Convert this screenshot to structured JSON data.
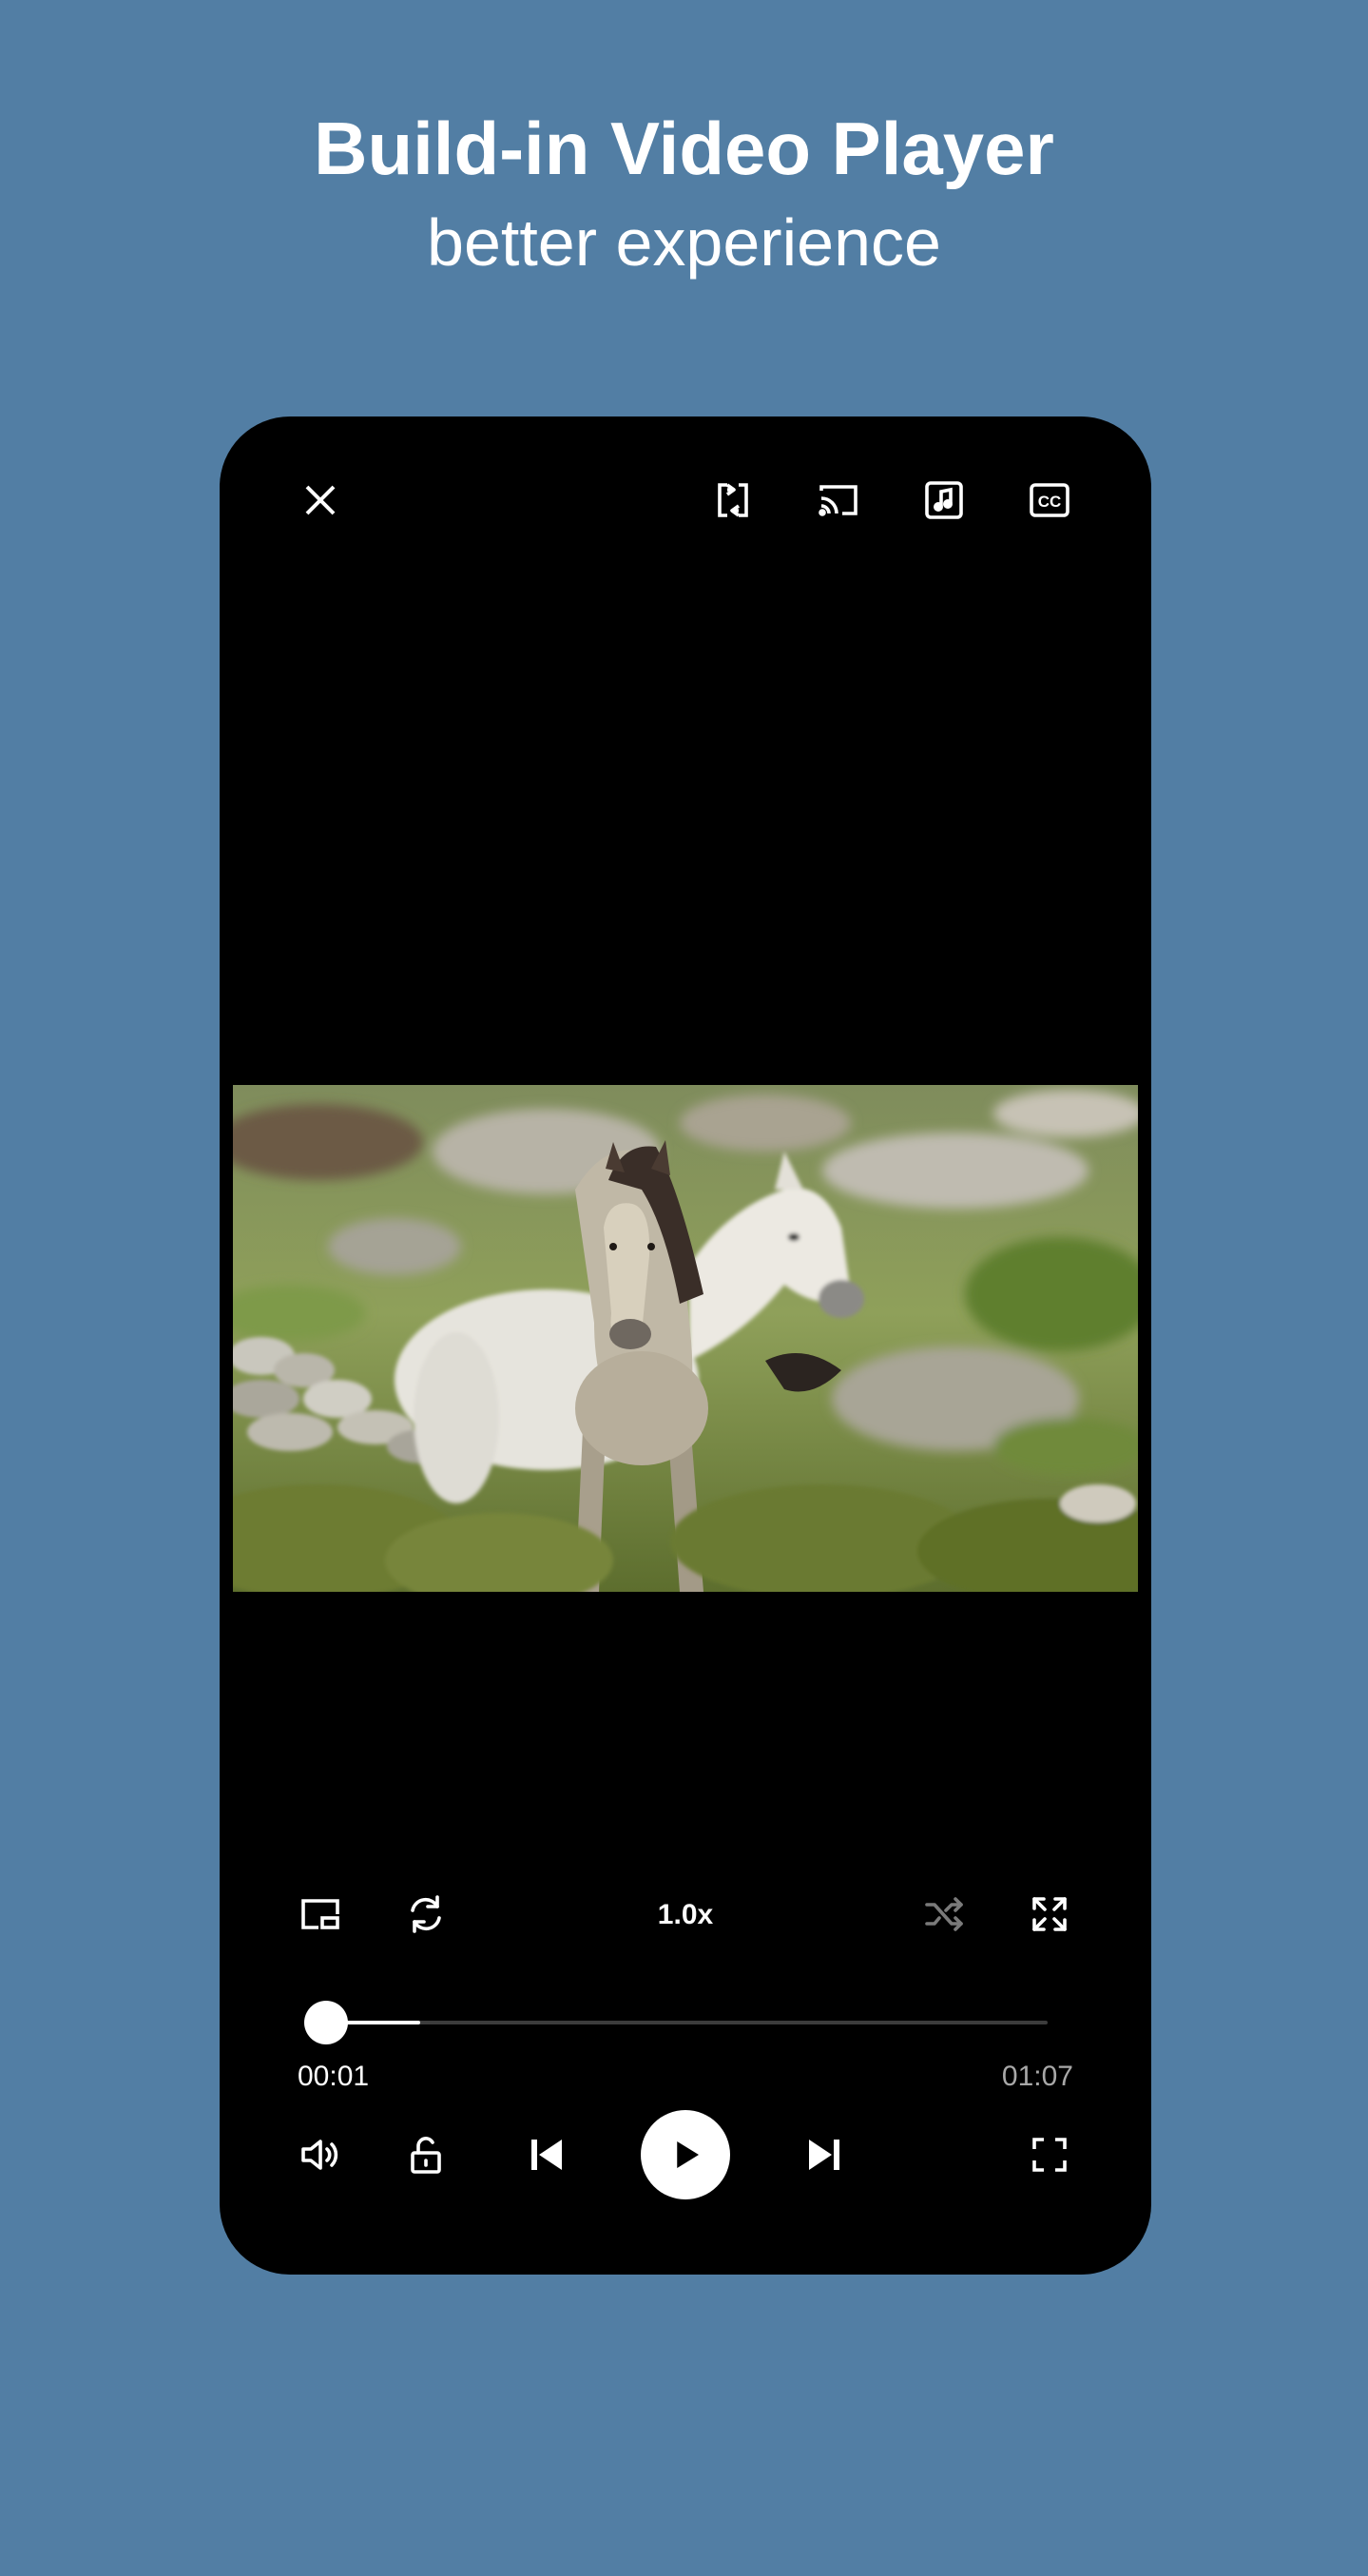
{
  "promo": {
    "title": "Build-in Video Player",
    "subtitle": "better experience"
  },
  "colors": {
    "background": "#527ea4",
    "player_bg": "#000000",
    "accent": "#ffffff",
    "muted_text": "#a8a8a8",
    "track": "#3c3c3c"
  },
  "top_bar": {
    "icons": [
      "close-icon",
      "rotate-screen-icon",
      "cast-icon",
      "audio-track-icon",
      "subtitles-icon"
    ],
    "subtitles_glyph": "CC"
  },
  "controls": {
    "speed_label": "1.0x",
    "icons": [
      "picture-in-picture-icon",
      "repeat-icon",
      "shuffle-icon",
      "resize-icon"
    ]
  },
  "seek": {
    "current_time": "00:01",
    "total_time": "01:07",
    "progress_fraction": 0.13
  },
  "bottom_bar": {
    "icons": [
      "volume-icon",
      "lock-icon",
      "previous-icon",
      "play-icon",
      "next-icon",
      "fullscreen-icon"
    ]
  }
}
